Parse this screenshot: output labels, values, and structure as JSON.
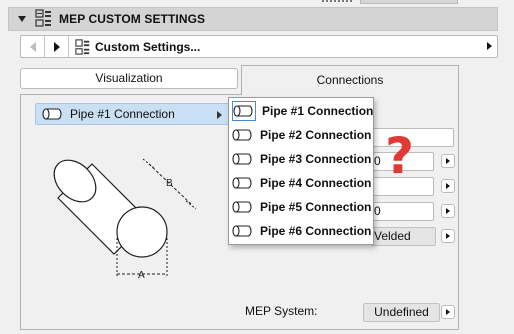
{
  "section": {
    "title": "MEP CUSTOM SETTINGS"
  },
  "settings_bar": {
    "label": "Custom Settings..."
  },
  "tabs": [
    {
      "label": "Visualization",
      "active": false
    },
    {
      "label": "Connections",
      "active": true
    }
  ],
  "pipe_selector": {
    "label": "Pipe #1 Connection"
  },
  "diagram": {
    "dim_a": "A",
    "dim_b": "B"
  },
  "menu": {
    "items": [
      {
        "label": "Pipe #1 Connection",
        "selected": true
      },
      {
        "label": "Pipe #2 Connection",
        "selected": false
      },
      {
        "label": "Pipe #3 Connection",
        "selected": false
      },
      {
        "label": "Pipe #4 Connection",
        "selected": false
      },
      {
        "label": "Pipe #5 Connection",
        "selected": false
      },
      {
        "label": "Pipe #6 Connection",
        "selected": false
      }
    ]
  },
  "fields": {
    "row2_value": "0",
    "row4_value": "0",
    "row5_value": "Velded"
  },
  "annotation": "?",
  "mep_system": {
    "label": "MEP System:",
    "value": "Undefined"
  },
  "colors": {
    "selection_blue": "#c9dff4",
    "question_mark": "#e03a34",
    "header_gray": "#d4d4d4"
  },
  "icons": {
    "header_icon": "settings-grid-icon",
    "settings_icon": "settings-grid-icon",
    "pipe_icon": "pipe-icon"
  }
}
